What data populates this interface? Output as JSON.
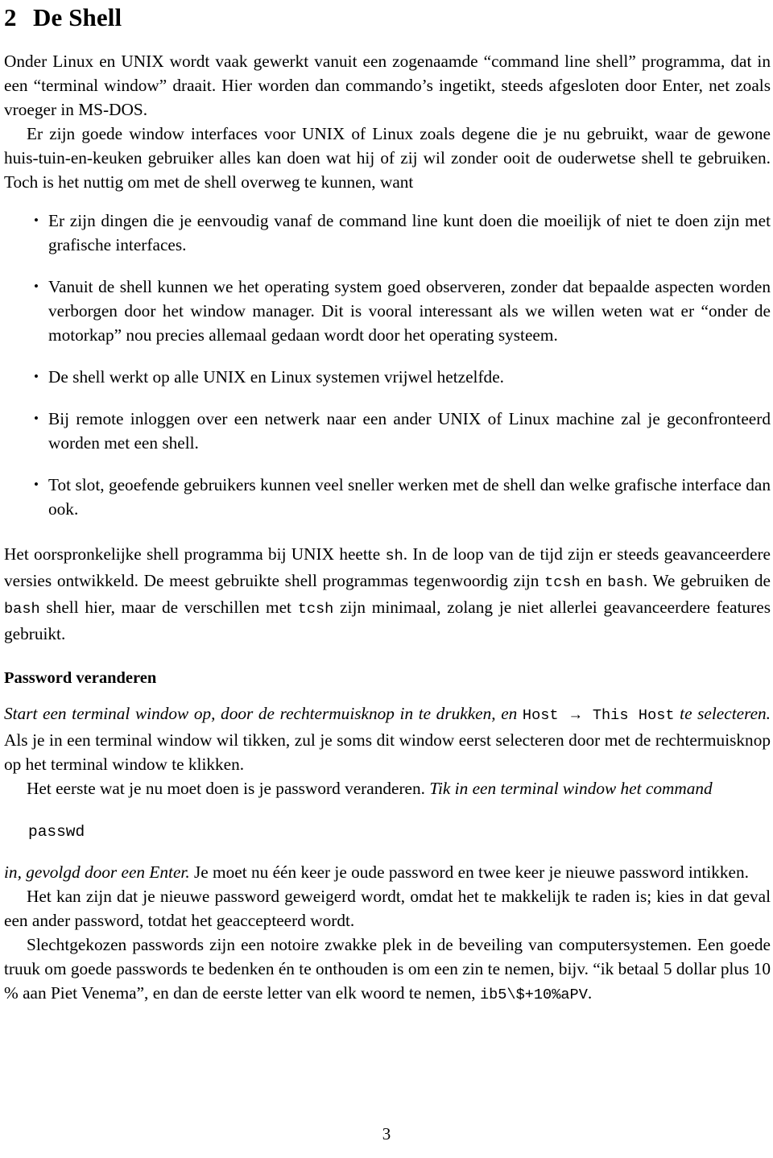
{
  "document": {
    "page_number": "3",
    "section": {
      "number": "2",
      "title": "De Shell"
    },
    "intro_paragraph_1": "Onder Linux en UNIX wordt vaak gewerkt vanuit een zogenaamde “command line shell” programma, dat in een “terminal window” draait.  Hier worden dan commando’s ingetikt, steeds afgesloten door Enter, net zoals vroeger in MS-DOS.",
    "intro_paragraph_2": "Er zijn goede window interfaces voor UNIX of Linux zoals degene die je nu gebruikt, waar de gewone huis-tuin-en-keuken gebruiker alles kan doen wat hij of zij wil zonder ooit de ouderwetse shell te gebruiken.  Toch is het nuttig om met de shell overweg te kunnen, want",
    "bullets": [
      "Er zijn dingen die je eenvoudig vanaf de command line kunt doen die moeilijk of niet te doen zijn met grafische interfaces.",
      "Vanuit de shell kunnen we het operating system goed observeren, zonder dat bepaalde aspecten worden verborgen door het window manager.  Dit is vooral interessant als we willen weten wat er “onder de motorkap” nou precies allemaal gedaan wordt door het operating systeem.",
      "De shell werkt op alle UNIX en Linux systemen vrijwel hetzelfde.",
      "Bij remote inloggen over een netwerk naar een ander UNIX of Linux machine zal je geconfronteerd worden met een shell.",
      "Tot slot, geoefende gebruikers kunnen veel sneller werken met de shell dan welke grafische interface dan ook."
    ],
    "shell_paragraph": {
      "part1": "Het oorspronkelijke shell programma bij UNIX heette ",
      "code_sh": "sh",
      "part2": ".  In de loop van de tijd zijn er steeds geavanceerdere versies ontwikkeld.  De meest gebruikte shell programmas tegenwoordig zijn ",
      "code_tcsh_1": "tcsh",
      "part3": " en ",
      "code_bash_1": "bash",
      "part4": ".  We gebruiken de ",
      "code_bash_2": "bash",
      "part5": " shell hier, maar de verschillen met ",
      "code_tcsh_2": "tcsh",
      "part6": " zijn minimaal, zolang je niet allerlei geavanceerdere features gebruikt."
    },
    "subsection": {
      "title": "Password veranderen"
    },
    "terminal_paragraph": {
      "italic1": "Start een terminal window op, door de rechtermuisknop in te drukken, en ",
      "code_host": "Host",
      "arrow": "→",
      "code_this_host": "This Host",
      "italic2": " te selecteren.",
      "rest": "  Als je in een terminal window wil tikken, zul je soms dit window eerst selecteren door met de rechtermuisknop op het terminal window te klikken."
    },
    "password_paragraph": {
      "part1": "Het eerste wat je nu moet doen is je password veranderen.  ",
      "italic": "Tik in een terminal window het command"
    },
    "code_block": "passwd",
    "after_code_paragraph": {
      "italic": "in, gevolgd door een Enter.",
      "rest": "  Je moet nu één keer je oude password en twee keer je nieuwe password intikken."
    },
    "refused_paragraph": "Het kan zijn dat je nieuwe password geweigerd wordt, omdat het te makkelijk te raden is; kies in dat geval een ander password, totdat het geaccepteerd wordt.",
    "weak_paragraph": {
      "part1": "Slechtgekozen passwords zijn een notoire zwakke plek in de beveiling van computersystemen.  Een goede truuk om goede passwords te bedenken én te onthouden is om een zin te nemen, bijv. “ik betaal 5 dollar plus 10 % aan Piet Venema”, en dan de eerste letter van elk woord te nemen, ",
      "code_example": "ib5\\$+10%aPV",
      "part2": "."
    }
  }
}
